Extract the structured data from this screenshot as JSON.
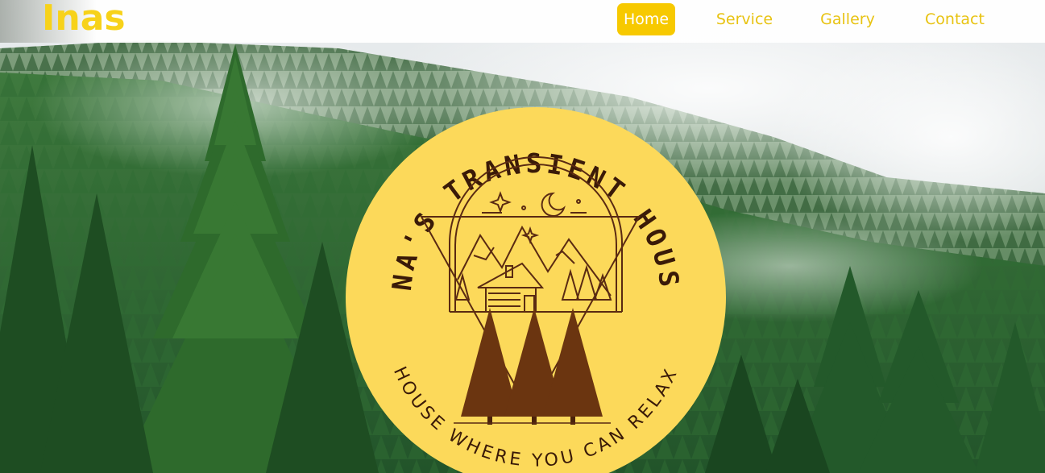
{
  "header": {
    "brand": "Inas",
    "nav": [
      {
        "label": "Home",
        "active": true
      },
      {
        "label": "Service",
        "active": false
      },
      {
        "label": "Gallery",
        "active": false
      },
      {
        "label": "Contact",
        "active": false
      }
    ]
  },
  "hero": {
    "background": "misty-pine-forest",
    "logo": {
      "top_text": "INA'S TRANSIENT HOUSE",
      "bottom_text": "HOUSE WHERE YOU CAN RELAX",
      "icon": "cabin-mountains-pines-emblem"
    }
  },
  "colors": {
    "accent": "#f7c900",
    "brand": "#f7d21a",
    "logo_bg": "#fcd95a",
    "logo_ink": "#5a2a12"
  }
}
